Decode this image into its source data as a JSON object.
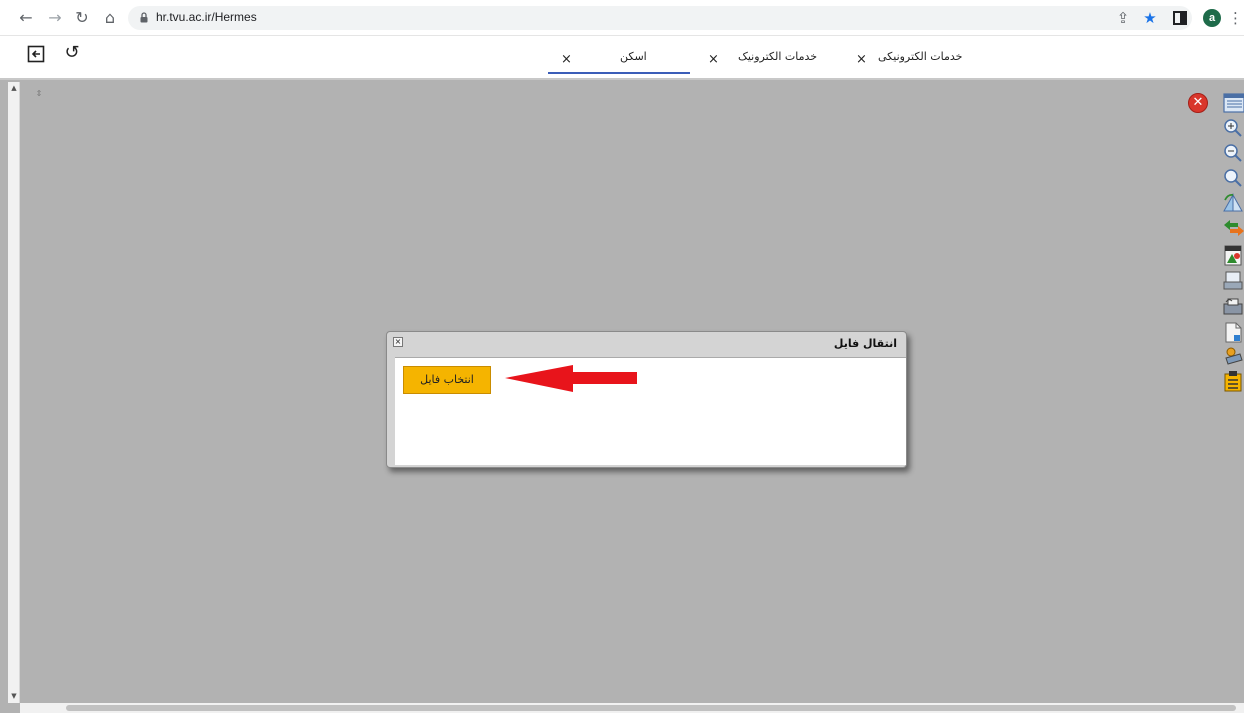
{
  "browser": {
    "url": "hr.tvu.ac.ir/Hermes",
    "avatar_letter": "a"
  },
  "toolbar": {
    "tabs": [
      {
        "label": "اسکن"
      },
      {
        "label": "خدمات الکترونیک"
      },
      {
        "label": "خدمات الکترونیکی"
      }
    ],
    "tab_close_glyph": "×"
  },
  "dialog": {
    "title": "انتقال فایل",
    "close_glyph": "×",
    "file_button_label": "انتخاب فایل"
  },
  "colors": {
    "viewer_bg": "#b2b2b2",
    "button_accent": "#f5b400",
    "annotation_arrow": "#e8141b",
    "active_tab_underline": "#3b5db8"
  },
  "icons": [
    "back-arrow-icon",
    "forward-arrow-icon",
    "reload-icon",
    "home-icon",
    "lock-icon",
    "share-icon",
    "star-icon",
    "sidebar-icon",
    "menu-dots-icon",
    "logout-icon",
    "refresh-icon",
    "close-viewer-icon",
    "page-view-icon",
    "zoom-in-icon",
    "zoom-out-icon",
    "zoom-fit-icon",
    "rotate-icon",
    "swap-icon",
    "tiff-icon",
    "scanner-icon",
    "fax-icon",
    "upload-doc-icon",
    "stamp-icon",
    "clipboard-icon"
  ]
}
